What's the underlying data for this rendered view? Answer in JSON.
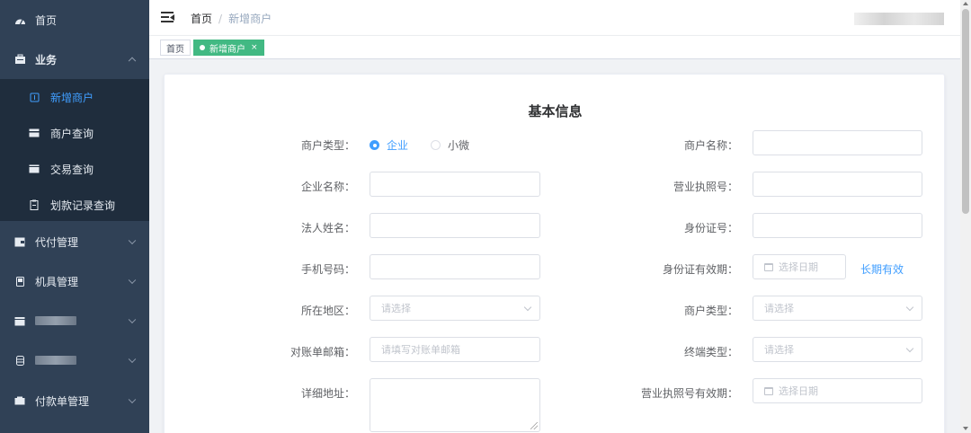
{
  "sidebar": {
    "items": [
      {
        "label": "首页",
        "icon": "dashboard-icon"
      },
      {
        "label": "业务",
        "icon": "briefcase-icon"
      },
      {
        "label": "代付管理",
        "icon": "wallet-icon"
      },
      {
        "label": "机具管理",
        "icon": "device-icon"
      },
      {
        "label": "",
        "icon": "calendar-icon"
      },
      {
        "label": "",
        "icon": "database-icon"
      },
      {
        "label": "付款单管理",
        "icon": "receipt-icon"
      }
    ],
    "sub_items": [
      {
        "label": "新增商户",
        "icon": "add-merchant-icon"
      },
      {
        "label": "商户查询",
        "icon": "card-icon"
      },
      {
        "label": "交易查询",
        "icon": "transaction-icon"
      },
      {
        "label": "划款记录查询",
        "icon": "clipboard-icon"
      }
    ]
  },
  "header": {
    "breadcrumb_home": "首页",
    "breadcrumb_sep": "/",
    "breadcrumb_current": "新增商户"
  },
  "tags": {
    "home": "首页",
    "active": "新增商户",
    "close": "×"
  },
  "form": {
    "title": "基本信息",
    "merchant_type_label": "商户类型：",
    "radio_enterprise": "企业",
    "radio_micro": "小微",
    "merchant_name_label": "商户名称：",
    "company_name_label": "企业名称：",
    "license_no_label": "营业执照号：",
    "legal_name_label": "法人姓名：",
    "id_no_label": "身份证号：",
    "phone_label": "手机号码：",
    "id_valid_label": "身份证有效期：",
    "id_valid_placeholder": "选择日期",
    "long_term_link": "长期有效",
    "region_label": "所在地区：",
    "region_placeholder": "请选择",
    "merchant_kind_label": "商户类型：",
    "merchant_kind_placeholder": "请选择",
    "email_label": "对账单邮箱：",
    "email_placeholder": "请填写对账单邮箱",
    "terminal_type_label": "终端类型：",
    "terminal_type_placeholder": "请选择",
    "address_label": "详细地址：",
    "license_valid_label": "营业执照号有效期：",
    "license_valid_placeholder": "选择日期"
  },
  "colors": {
    "sidebar_bg": "#304156",
    "submenu_bg": "#1f2d3d",
    "accent": "#409eff",
    "tag_active": "#42b983"
  }
}
